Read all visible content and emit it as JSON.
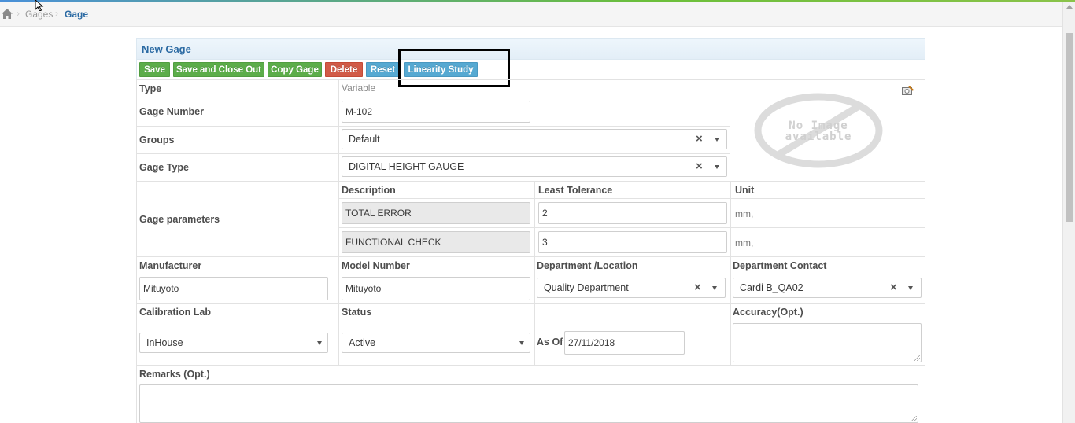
{
  "breadcrumb": {
    "items": [
      "Gages",
      "Gage"
    ]
  },
  "panel": {
    "title": "New Gage"
  },
  "toolbar": {
    "save": "Save",
    "save_close": "Save and Close Out",
    "copy": "Copy Gage",
    "delete": "Delete",
    "reset": "Reset",
    "linearity": "Linearity Study"
  },
  "form": {
    "type_label": "Type",
    "type_value": "Variable",
    "gage_number_label": "Gage Number",
    "gage_number_value": "M-102",
    "groups_label": "Groups",
    "groups_value": "Default",
    "gage_type_label": "Gage Type",
    "gage_type_value": "DIGITAL HEIGHT GAUGE",
    "image_placeholder": [
      "No Image",
      "available"
    ]
  },
  "parameters": {
    "label": "Gage parameters",
    "columns": [
      "Description",
      "Least Tolerance",
      "Unit"
    ],
    "rows": [
      {
        "description": "TOTAL ERROR",
        "tolerance": "2",
        "unit": "mm,"
      },
      {
        "description": "FUNCTIONAL CHECK",
        "tolerance": "3",
        "unit": "mm,"
      }
    ]
  },
  "details": {
    "manufacturer_label": "Manufacturer",
    "manufacturer_value": "Mituyoto",
    "model_label": "Model Number",
    "model_value": "Mituyoto",
    "department_label": "Department /Location",
    "department_value": "Quality Department",
    "contact_label": "Department Contact",
    "contact_value": "Cardi B_QA02",
    "cal_lab_label": "Calibration Lab",
    "cal_lab_value": "InHouse",
    "status_label": "Status",
    "status_value": "Active",
    "as_of_label": "As Of",
    "as_of_value": "27/11/2018",
    "accuracy_label": "Accuracy(Opt.)",
    "accuracy_value": "",
    "remarks_label": "Remarks (Opt.)",
    "remarks_value": ""
  },
  "icons": {
    "home": "home-icon",
    "camera": "camera-icon",
    "clear": "×",
    "caret": "caret-down-icon"
  },
  "colors": {
    "button_green": "#5cad4a",
    "button_red": "#d15b47",
    "button_blue": "#56a9d2",
    "title_blue": "#2b6aa3"
  }
}
